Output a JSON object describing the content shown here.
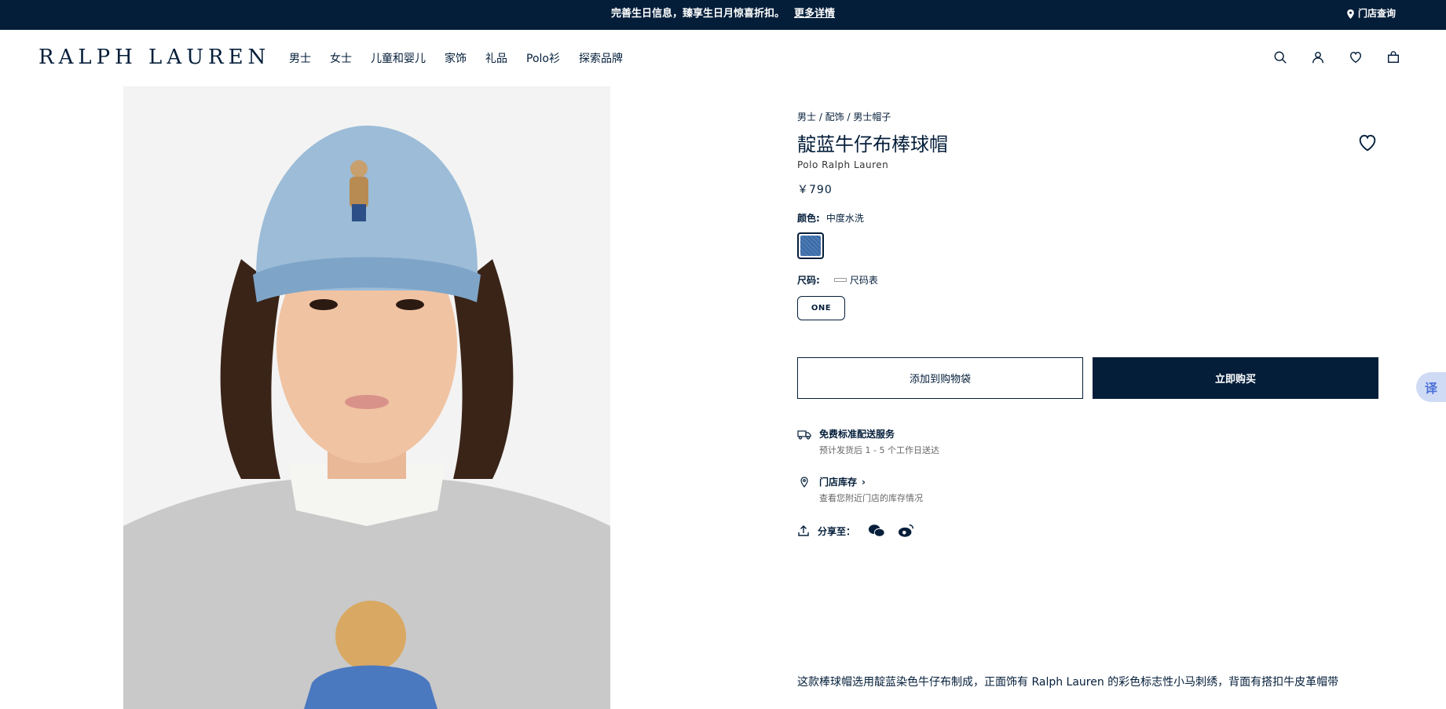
{
  "promo": {
    "text": "完善生日信息，臻享生日月惊喜折扣。",
    "link": "更多详情",
    "store_lookup": "门店查询"
  },
  "header": {
    "logo": "RALPH LAUREN",
    "nav": [
      "男士",
      "女士",
      "儿童和婴儿",
      "家饰",
      "礼品",
      "Polo衫",
      "探索品牌"
    ],
    "icons": [
      "search-icon",
      "account-icon",
      "wishlist-icon",
      "bag-icon"
    ]
  },
  "product": {
    "breadcrumb": "男士 / 配饰 / 男士帽子",
    "title": "靛蓝牛仔布棒球帽",
    "brand": "Polo Ralph Lauren",
    "price": "￥790",
    "color_label": "颜色:",
    "color_value": "中度水洗",
    "size_label": "尺码:",
    "size_guide": "尺码表",
    "size_option": "ONE",
    "add_to_cart": "添加到购物袋",
    "buy_now": "立即购买",
    "shipping_title": "免费标准配送服务",
    "shipping_sub": "预计发货后 1 - 5 个工作日送达",
    "store_title": "门店库存",
    "store_sub": "查看您附近门店的库存情况",
    "share_label": "分享至：",
    "description": "这款棒球帽选用靛蓝染色牛仔布制成，正面饰有 Ralph Lauren 的彩色标志性小马刺绣，背面有搭扣牛皮革帽带"
  },
  "translate_fab": "译",
  "colors": {
    "navy": "#041e3a",
    "denim": "#3b6aa3"
  }
}
